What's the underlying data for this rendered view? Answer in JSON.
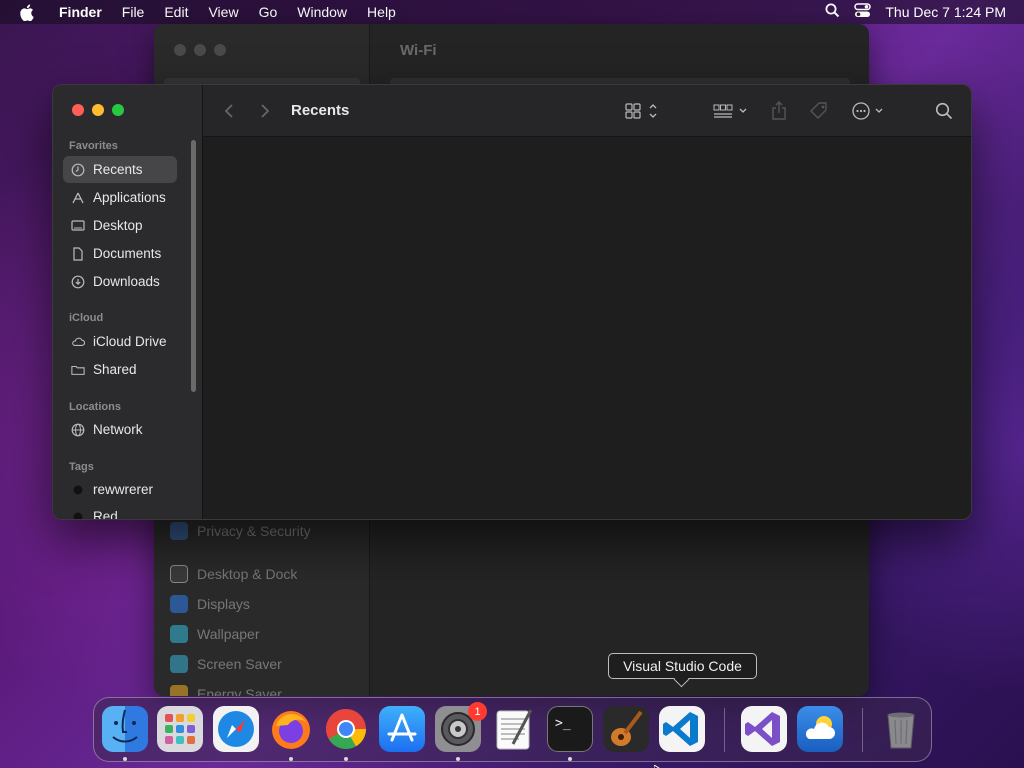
{
  "menubar": {
    "app_name": "Finder",
    "items": [
      "File",
      "Edit",
      "View",
      "Go",
      "Window",
      "Help"
    ],
    "clock": "Thu Dec 7  1:24 PM"
  },
  "system_settings": {
    "title": "Wi-Fi",
    "items": [
      {
        "label": "Privacy & Security",
        "color": "#3b7bd8"
      },
      {
        "label": "Desktop & Dock",
        "color": "#3a3a3a"
      },
      {
        "label": "Displays",
        "color": "#2f79e0"
      },
      {
        "label": "Wallpaper",
        "color": "#34b0d0"
      },
      {
        "label": "Screen Saver",
        "color": "#38a7c8"
      },
      {
        "label": "Energy Saver",
        "color": "#e0a526"
      }
    ]
  },
  "finder": {
    "title": "Recents",
    "sidebar": {
      "favorites_header": "Favorites",
      "favorites": [
        "Recents",
        "Applications",
        "Desktop",
        "Documents",
        "Downloads"
      ],
      "icloud_header": "iCloud",
      "icloud": [
        "iCloud Drive",
        "Shared"
      ],
      "locations_header": "Locations",
      "locations": [
        "Network"
      ],
      "tags_header": "Tags",
      "tags": [
        "rewwrerer",
        "Red"
      ]
    }
  },
  "dock": {
    "tooltip": "Visual Studio Code",
    "apps": [
      "Finder",
      "Launchpad",
      "Safari",
      "Firefox",
      "Google Chrome",
      "App Store",
      "System Settings",
      "TextEdit",
      "Terminal",
      "GarageBand",
      "Visual Studio Code",
      "Visual Studio",
      "Weather",
      "Trash"
    ],
    "system_settings_badge": "1"
  }
}
